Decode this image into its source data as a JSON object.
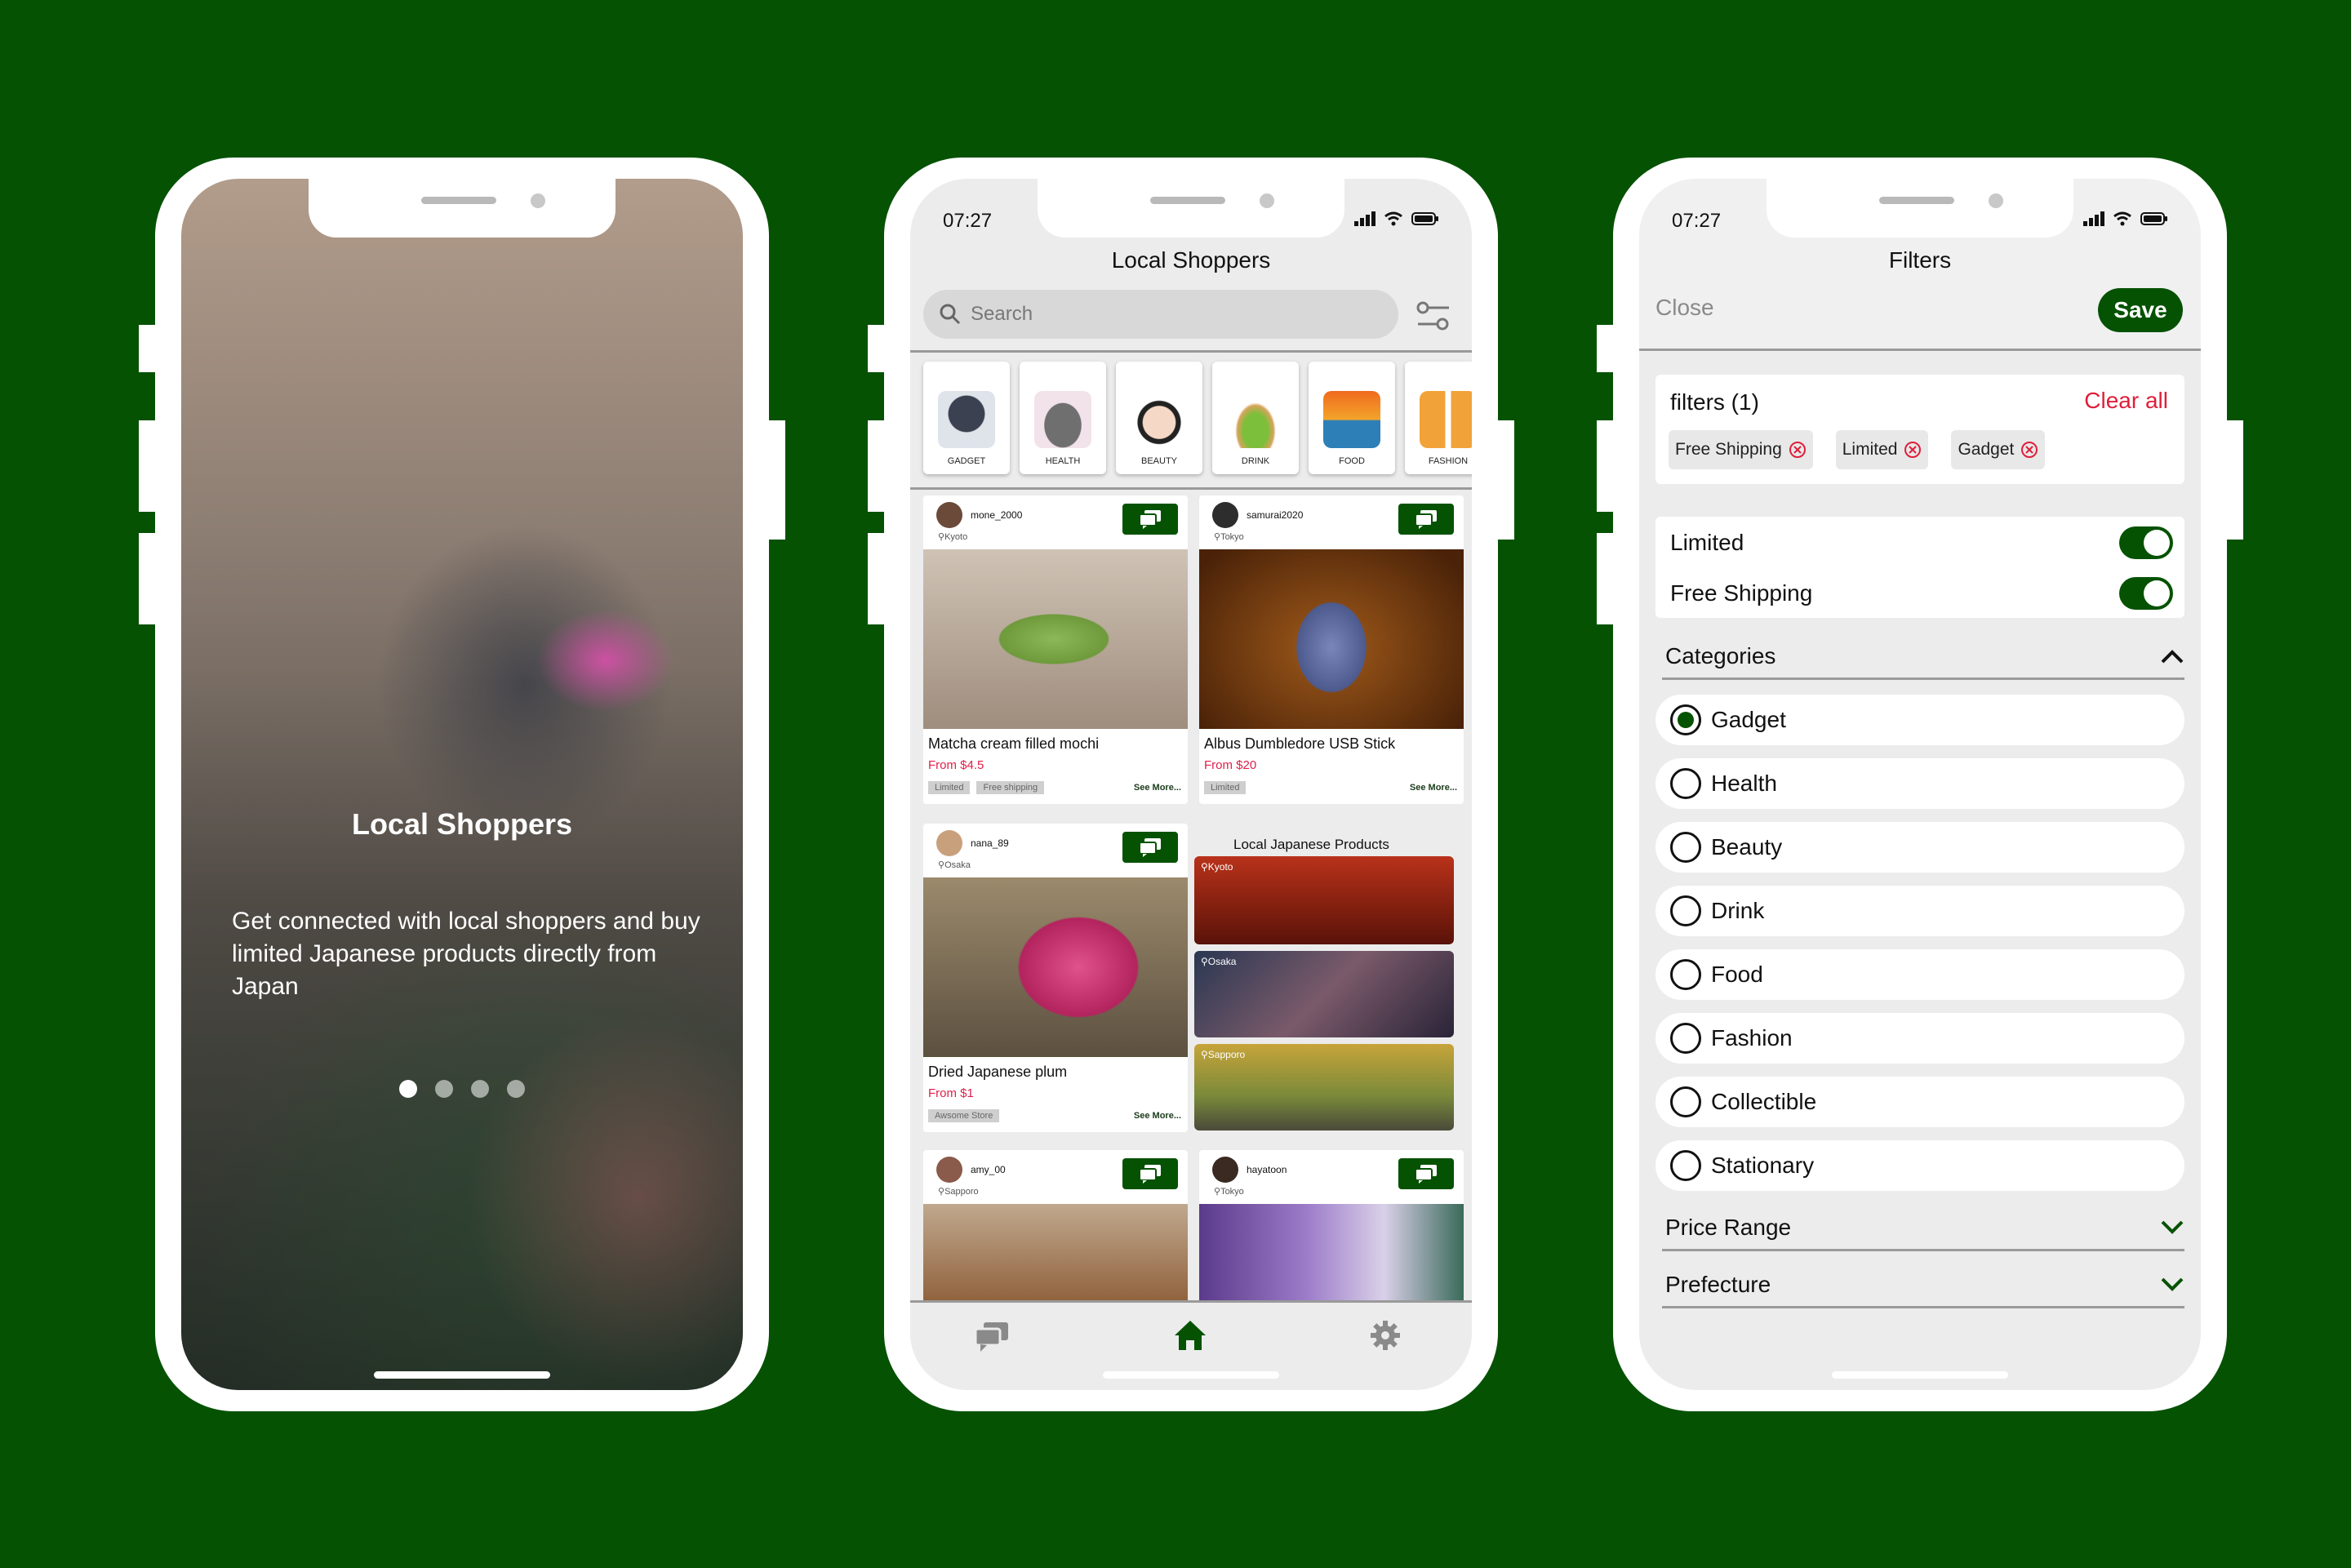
{
  "colors": {
    "background": "#055203",
    "accent": "#055203",
    "price": "#e01e4a",
    "clear": "#e01e3a"
  },
  "onboarding": {
    "title": "Local Shoppers",
    "description": "Get connected with local shoppers and buy limited Japanese products directly from Japan",
    "page_index": 1,
    "page_count": 4
  },
  "feed": {
    "time": "07:27",
    "title": "Local Shoppers",
    "search_placeholder": "Search",
    "categories": [
      "GADGET",
      "HEALTH",
      "BEAUTY",
      "DRINK",
      "FOOD",
      "FASHION"
    ],
    "posts": [
      {
        "user": "mone_2000",
        "location": "Kyoto",
        "product": "Matcha cream filled mochi",
        "price": "From $4.5",
        "tags": [
          "Limited",
          "Free shipping"
        ],
        "see_more": "See More..."
      },
      {
        "user": "samurai2020",
        "location": "Tokyo",
        "product": "Albus Dumbledore USB Stick",
        "price": "From $20",
        "tags": [
          "Limited"
        ],
        "see_more": "See More..."
      },
      {
        "user": "nana_89",
        "location": "Osaka",
        "product": "Dried Japanese plum",
        "price": "From $1",
        "tags": [
          "Awsome Store"
        ],
        "see_more": "See More..."
      },
      {
        "user": "amy_00",
        "location": "Sapporo"
      },
      {
        "user": "hayatoon",
        "location": "Tokyo"
      }
    ],
    "local_section_title": "Local Japanese Products",
    "cities": [
      "Kyoto",
      "Osaka",
      "Sapporo"
    ]
  },
  "filters": {
    "time": "07:27",
    "title": "Filters",
    "close_label": "Close",
    "save_label": "Save",
    "active_title": "filters (1)",
    "clear_all_label": "Clear all",
    "chips": [
      "Free Shipping",
      "Limited",
      "Gadget"
    ],
    "toggles": [
      {
        "label": "Limited",
        "on": true
      },
      {
        "label": "Free Shipping",
        "on": true
      }
    ],
    "categories_label": "Categories",
    "category_options": [
      "Gadget",
      "Health",
      "Beauty",
      "Drink",
      "Food",
      "Fashion",
      "Collectible",
      "Stationary"
    ],
    "selected_category": "Gadget",
    "price_range_label": "Price Range",
    "prefecture_label": "Prefecture"
  }
}
